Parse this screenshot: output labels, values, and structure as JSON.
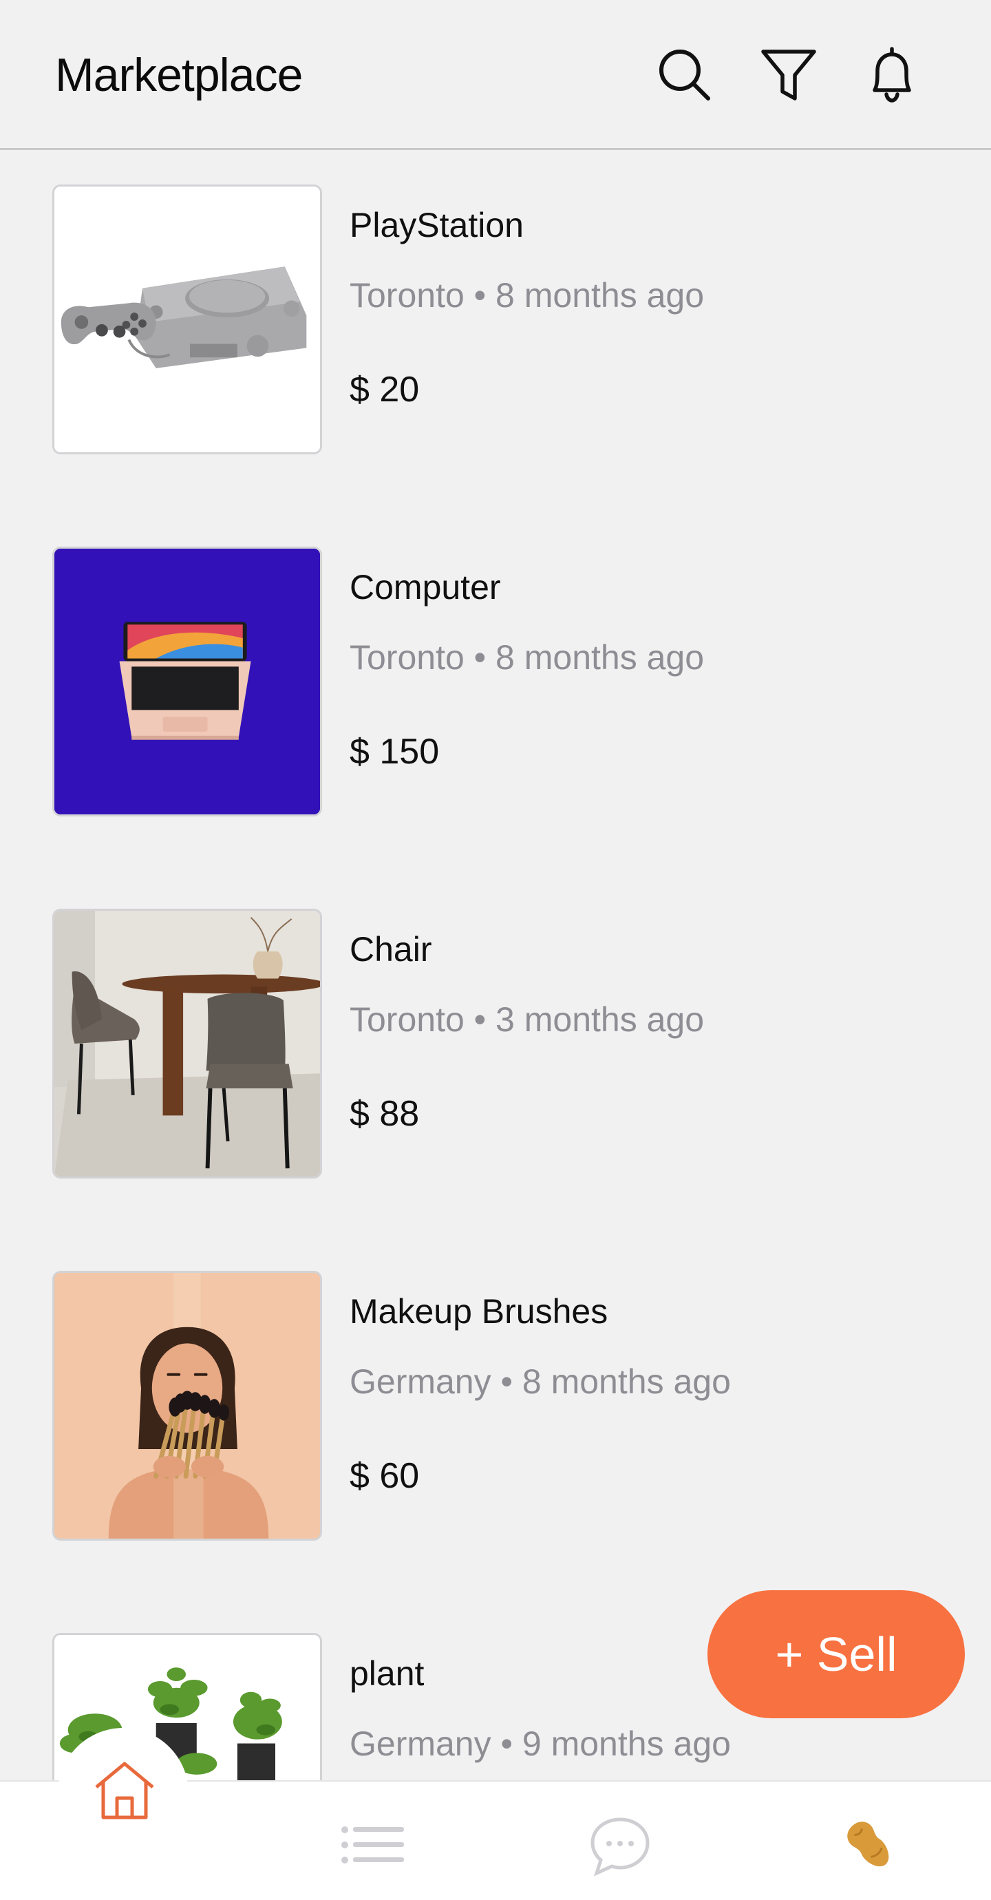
{
  "header": {
    "title": "Marketplace",
    "icons": [
      "search-icon",
      "filter-icon",
      "bell-icon"
    ]
  },
  "listings": [
    {
      "title": "PlayStation",
      "meta": "Toronto • 8 months ago",
      "price": "$ 20",
      "image": "playstation-console"
    },
    {
      "title": "Computer",
      "meta": "Toronto • 8 months ago",
      "price": "$ 150",
      "image": "laptop-on-blue"
    },
    {
      "title": "Chair",
      "meta": "Toronto • 3 months ago",
      "price": "$ 88",
      "image": "dining-chairs"
    },
    {
      "title": "Makeup Brushes",
      "meta": "Germany • 8 months ago",
      "price": "$ 60",
      "image": "woman-with-brushes"
    },
    {
      "title": "plant",
      "meta": "Germany • 9 months ago",
      "price": "",
      "image": "potted-plants"
    }
  ],
  "sell_button": {
    "label": "+ Sell"
  },
  "bottom_nav": {
    "items": [
      "home-icon",
      "list-icon",
      "chat-icon",
      "peanut-icon"
    ],
    "active": "home-icon"
  },
  "colors": {
    "accent": "#f87141",
    "background": "#f1f1f2",
    "meta_text": "#8d8d93",
    "computer_bg": "#3212b8"
  }
}
